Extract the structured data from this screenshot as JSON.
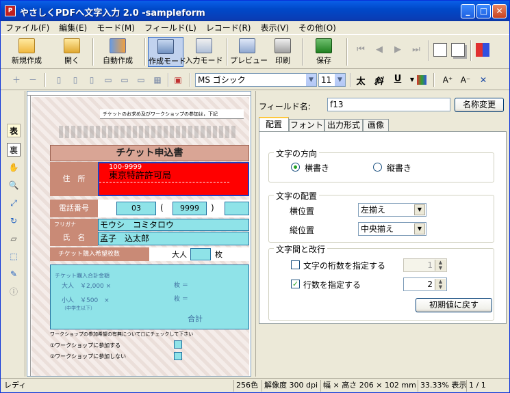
{
  "title": "やさしくPDFへ文字入力 2.0 -sampleform",
  "window_controls": {
    "minimize": "_",
    "maximize": "□",
    "close": "✕"
  },
  "menu": [
    "ファイル(F)",
    "編集(E)",
    "モード(M)",
    "フィールド(L)",
    "レコード(R)",
    "表示(V)",
    "その他(O)"
  ],
  "toolbar": {
    "new": "新規作成",
    "open": "開く",
    "auto_create": "自動作成",
    "create_mode": "作成モード",
    "input_mode": "入力モード",
    "preview": "プレビュー",
    "print": "印刷",
    "save": "保存"
  },
  "format_bar": {
    "font": "MS ゴシック",
    "size": "11",
    "bold": "太",
    "italic": "斜",
    "underline": "U"
  },
  "document": {
    "note_top": "チケットのお求め及びワークショップの参加は，下記",
    "form_title": "チケット申込書",
    "address_label": "住　所",
    "postal": "100-9999",
    "address": "東京特許許可局",
    "phone_label": "電話番号",
    "phone1": "03",
    "phone2": "9999",
    "furigana_label": "フリガナ",
    "furigana": "モウシ　コミタロウ",
    "name_label": "氏　名",
    "name": "孟子　込太郎",
    "ticket_label": "チケット購入希望枚数",
    "adult_label": "大人",
    "unit": "枚",
    "total_label": "チケット購入合計金額",
    "adult_price": "大人　￥2,000 ×",
    "child_price": "小人　￥500　×",
    "child_note": "（中学生以下）",
    "per": "枚 ＝",
    "total": "合計",
    "workshop_q": "ワークショップの参加希望の有無について□にチェックして下さい",
    "workshop_1": "①ワークショップに参加する",
    "workshop_2": "②ワークショップに参加しない"
  },
  "panel": {
    "field_name_label": "フィールド名:",
    "field_name_value": "f13",
    "rename_button": "名称変更",
    "tabs": [
      "配置",
      "フォント",
      "出力形式",
      "画像"
    ],
    "direction_group": "文字の方向",
    "horizontal": "横書き",
    "vertical": "縦書き",
    "layout_group": "文字の配置",
    "h_align_label": "横位置",
    "h_align_value": "左揃え",
    "v_align_label": "縦位置",
    "v_align_value": "中央揃え",
    "spacing_group": "文字間と改行",
    "digits_label": "文字の桁数を指定する",
    "digits_value": "1",
    "lines_label": "行数を指定する",
    "lines_value": "2",
    "reset_button": "初期値に戻す"
  },
  "status": {
    "ready": "レディ",
    "colors": "256色",
    "resolution": "解像度 300 dpi",
    "size": "幅 × 高さ 206 × 102 mm",
    "zoom": "33.33% 表示",
    "page": "1 / 1"
  },
  "colors": {
    "accent": "#316AC5",
    "red_field": "#FF0000",
    "cyan_field": "#8FE3E8",
    "form_header": "#D0826A"
  }
}
